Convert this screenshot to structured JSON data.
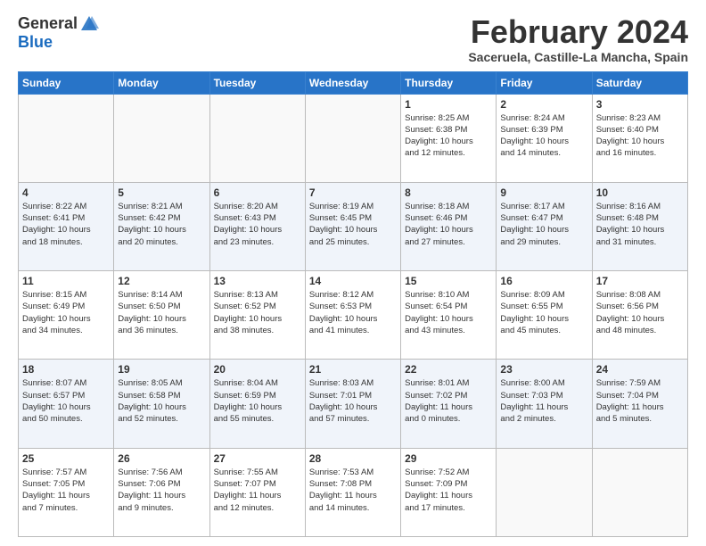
{
  "header": {
    "logo_general": "General",
    "logo_blue": "Blue",
    "title": "February 2024",
    "location": "Saceruela, Castille-La Mancha, Spain"
  },
  "weekdays": [
    "Sunday",
    "Monday",
    "Tuesday",
    "Wednesday",
    "Thursday",
    "Friday",
    "Saturday"
  ],
  "weeks": [
    [
      {
        "day": "",
        "info": ""
      },
      {
        "day": "",
        "info": ""
      },
      {
        "day": "",
        "info": ""
      },
      {
        "day": "",
        "info": ""
      },
      {
        "day": "1",
        "info": "Sunrise: 8:25 AM\nSunset: 6:38 PM\nDaylight: 10 hours\nand 12 minutes."
      },
      {
        "day": "2",
        "info": "Sunrise: 8:24 AM\nSunset: 6:39 PM\nDaylight: 10 hours\nand 14 minutes."
      },
      {
        "day": "3",
        "info": "Sunrise: 8:23 AM\nSunset: 6:40 PM\nDaylight: 10 hours\nand 16 minutes."
      }
    ],
    [
      {
        "day": "4",
        "info": "Sunrise: 8:22 AM\nSunset: 6:41 PM\nDaylight: 10 hours\nand 18 minutes."
      },
      {
        "day": "5",
        "info": "Sunrise: 8:21 AM\nSunset: 6:42 PM\nDaylight: 10 hours\nand 20 minutes."
      },
      {
        "day": "6",
        "info": "Sunrise: 8:20 AM\nSunset: 6:43 PM\nDaylight: 10 hours\nand 23 minutes."
      },
      {
        "day": "7",
        "info": "Sunrise: 8:19 AM\nSunset: 6:45 PM\nDaylight: 10 hours\nand 25 minutes."
      },
      {
        "day": "8",
        "info": "Sunrise: 8:18 AM\nSunset: 6:46 PM\nDaylight: 10 hours\nand 27 minutes."
      },
      {
        "day": "9",
        "info": "Sunrise: 8:17 AM\nSunset: 6:47 PM\nDaylight: 10 hours\nand 29 minutes."
      },
      {
        "day": "10",
        "info": "Sunrise: 8:16 AM\nSunset: 6:48 PM\nDaylight: 10 hours\nand 31 minutes."
      }
    ],
    [
      {
        "day": "11",
        "info": "Sunrise: 8:15 AM\nSunset: 6:49 PM\nDaylight: 10 hours\nand 34 minutes."
      },
      {
        "day": "12",
        "info": "Sunrise: 8:14 AM\nSunset: 6:50 PM\nDaylight: 10 hours\nand 36 minutes."
      },
      {
        "day": "13",
        "info": "Sunrise: 8:13 AM\nSunset: 6:52 PM\nDaylight: 10 hours\nand 38 minutes."
      },
      {
        "day": "14",
        "info": "Sunrise: 8:12 AM\nSunset: 6:53 PM\nDaylight: 10 hours\nand 41 minutes."
      },
      {
        "day": "15",
        "info": "Sunrise: 8:10 AM\nSunset: 6:54 PM\nDaylight: 10 hours\nand 43 minutes."
      },
      {
        "day": "16",
        "info": "Sunrise: 8:09 AM\nSunset: 6:55 PM\nDaylight: 10 hours\nand 45 minutes."
      },
      {
        "day": "17",
        "info": "Sunrise: 8:08 AM\nSunset: 6:56 PM\nDaylight: 10 hours\nand 48 minutes."
      }
    ],
    [
      {
        "day": "18",
        "info": "Sunrise: 8:07 AM\nSunset: 6:57 PM\nDaylight: 10 hours\nand 50 minutes."
      },
      {
        "day": "19",
        "info": "Sunrise: 8:05 AM\nSunset: 6:58 PM\nDaylight: 10 hours\nand 52 minutes."
      },
      {
        "day": "20",
        "info": "Sunrise: 8:04 AM\nSunset: 6:59 PM\nDaylight: 10 hours\nand 55 minutes."
      },
      {
        "day": "21",
        "info": "Sunrise: 8:03 AM\nSunset: 7:01 PM\nDaylight: 10 hours\nand 57 minutes."
      },
      {
        "day": "22",
        "info": "Sunrise: 8:01 AM\nSunset: 7:02 PM\nDaylight: 11 hours\nand 0 minutes."
      },
      {
        "day": "23",
        "info": "Sunrise: 8:00 AM\nSunset: 7:03 PM\nDaylight: 11 hours\nand 2 minutes."
      },
      {
        "day": "24",
        "info": "Sunrise: 7:59 AM\nSunset: 7:04 PM\nDaylight: 11 hours\nand 5 minutes."
      }
    ],
    [
      {
        "day": "25",
        "info": "Sunrise: 7:57 AM\nSunset: 7:05 PM\nDaylight: 11 hours\nand 7 minutes."
      },
      {
        "day": "26",
        "info": "Sunrise: 7:56 AM\nSunset: 7:06 PM\nDaylight: 11 hours\nand 9 minutes."
      },
      {
        "day": "27",
        "info": "Sunrise: 7:55 AM\nSunset: 7:07 PM\nDaylight: 11 hours\nand 12 minutes."
      },
      {
        "day": "28",
        "info": "Sunrise: 7:53 AM\nSunset: 7:08 PM\nDaylight: 11 hours\nand 14 minutes."
      },
      {
        "day": "29",
        "info": "Sunrise: 7:52 AM\nSunset: 7:09 PM\nDaylight: 11 hours\nand 17 minutes."
      },
      {
        "day": "",
        "info": ""
      },
      {
        "day": "",
        "info": ""
      }
    ]
  ]
}
